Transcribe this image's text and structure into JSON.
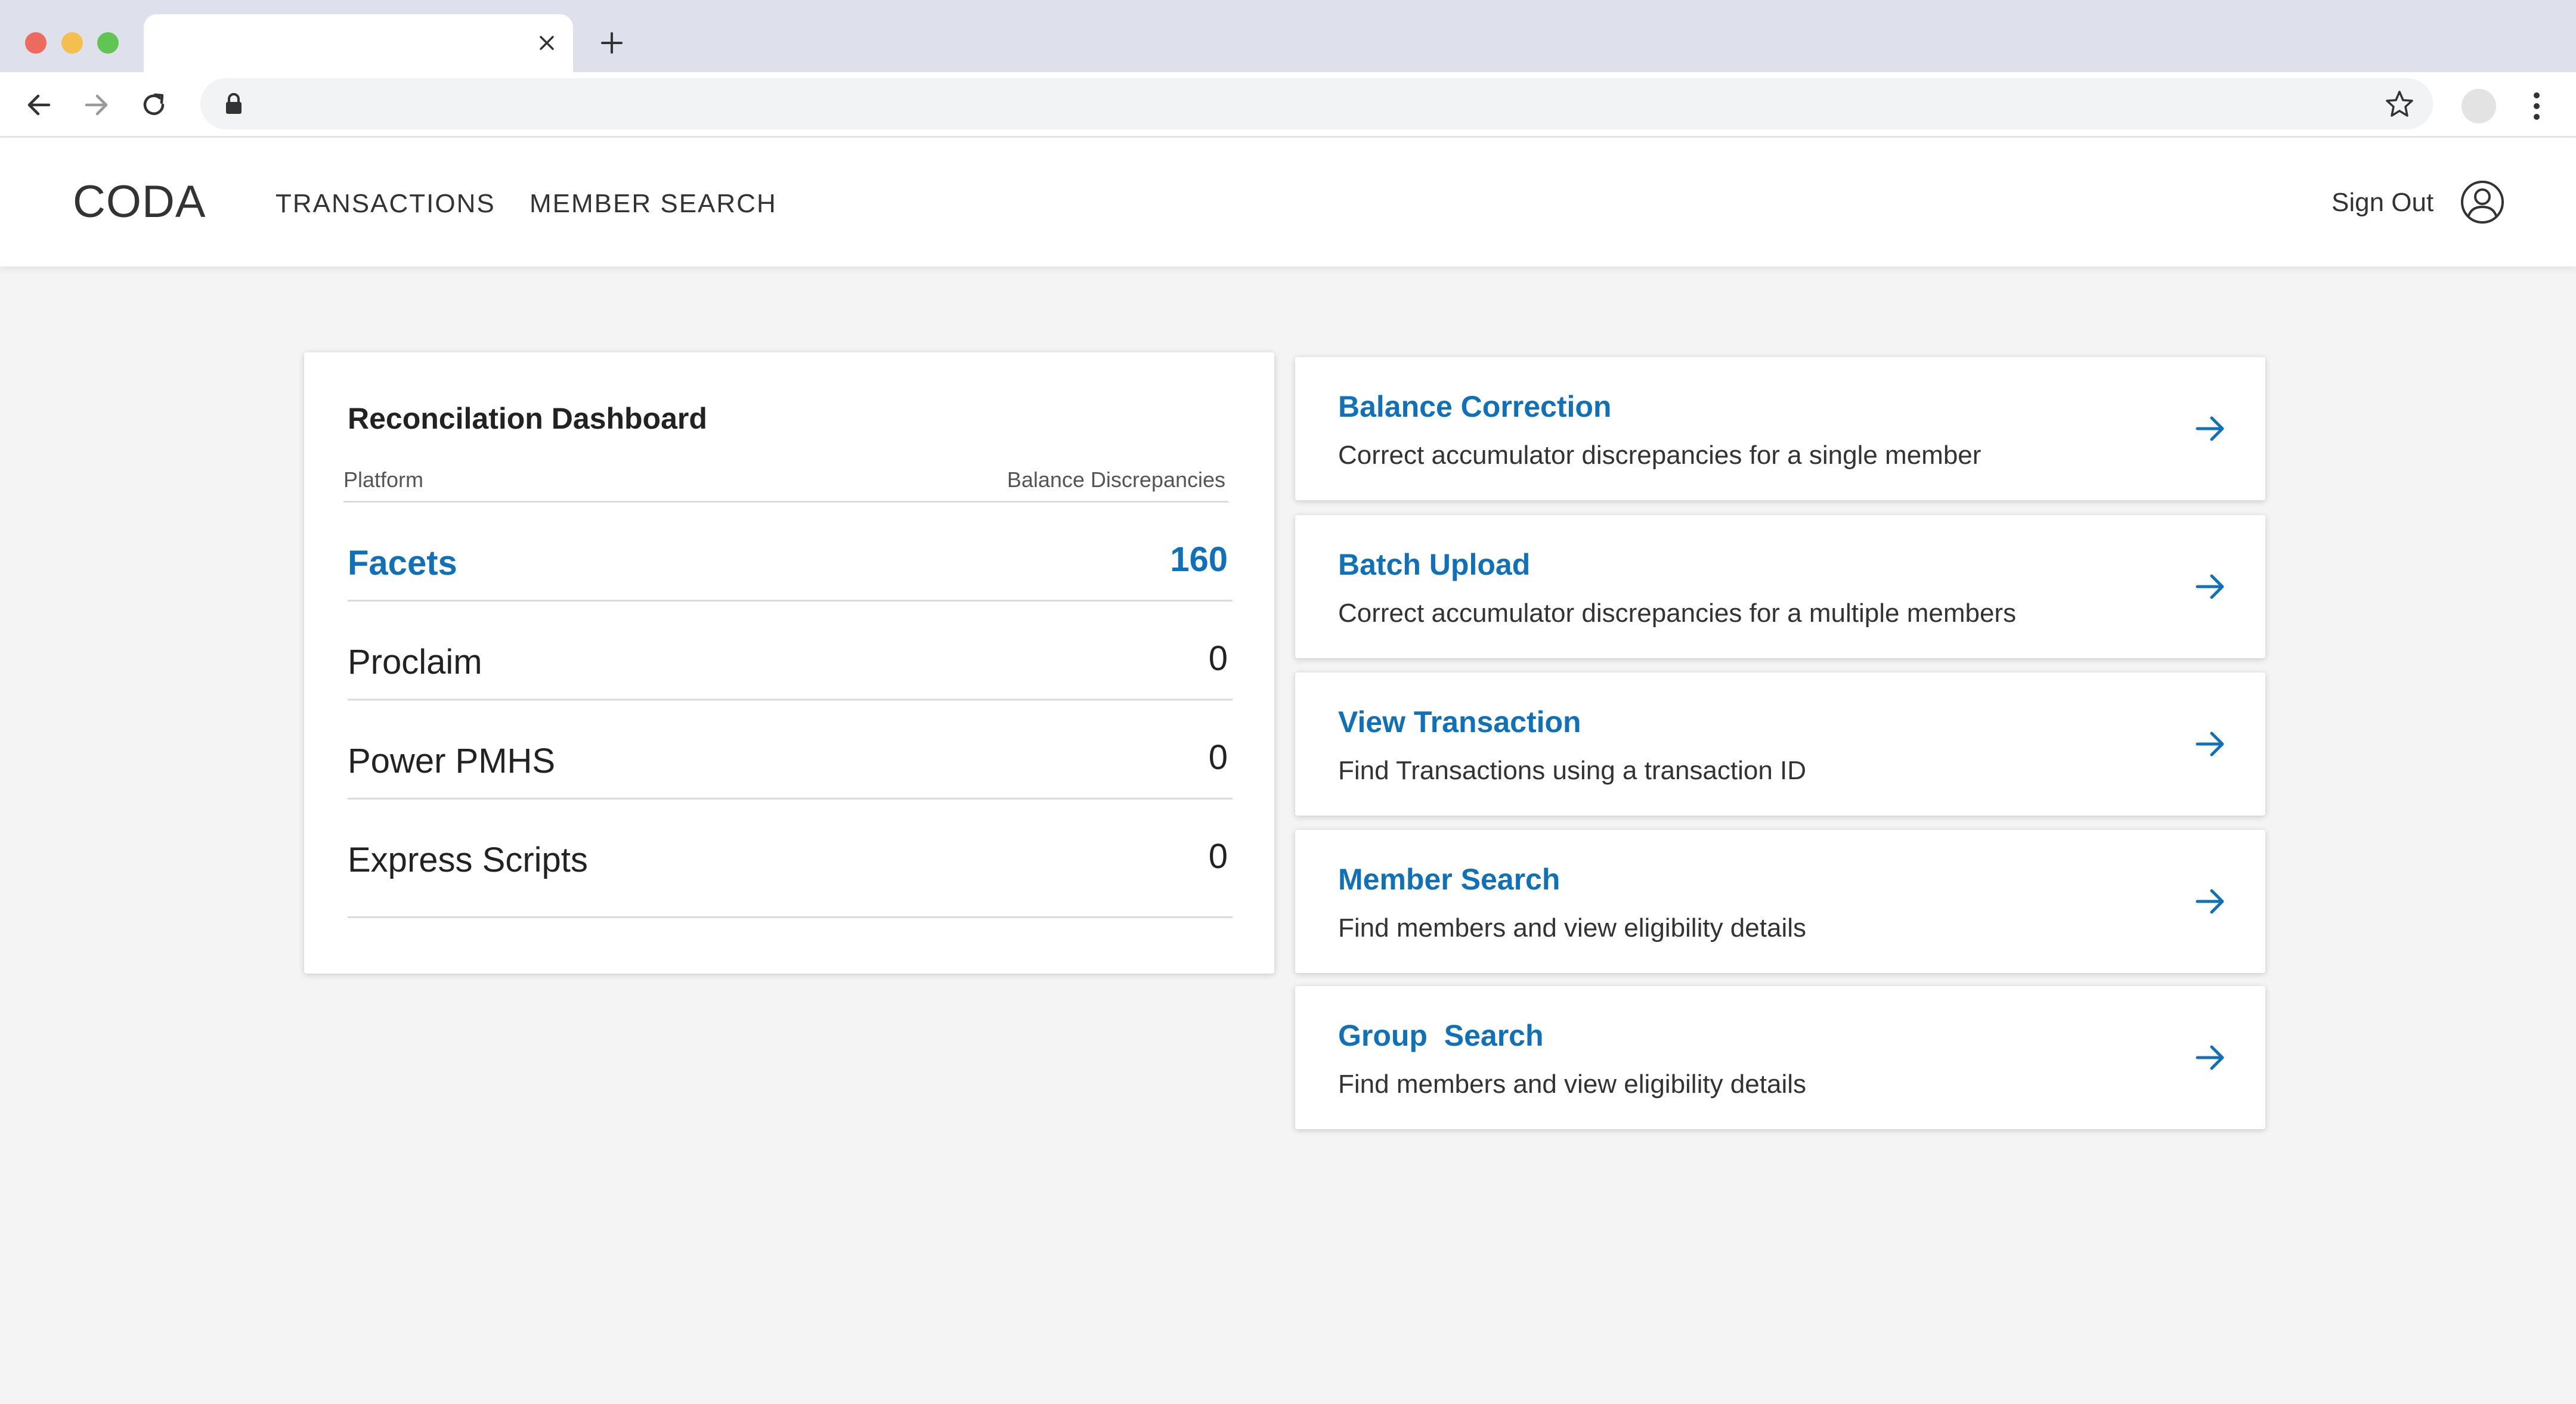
{
  "browser": {
    "tab_title": "",
    "address_value": "",
    "icons": [
      "close-icon",
      "plus-icon",
      "back-arrow-icon",
      "forward-arrow-icon",
      "reload-icon",
      "lock-icon",
      "star-icon",
      "kebab-menu-icon"
    ]
  },
  "header": {
    "brand": "CODA",
    "nav": [
      {
        "label": "TRANSACTIONS"
      },
      {
        "label": "MEMBER SEARCH"
      }
    ],
    "sign_out": "Sign Out",
    "user_icon": "user-circle-icon"
  },
  "recon": {
    "title": "Reconcilation Dashboard",
    "columns": {
      "platform": "Platform",
      "discrepancies": "Balance Discrepancies"
    },
    "rows": [
      {
        "platform": "Facets",
        "value": "160",
        "active": true
      },
      {
        "platform": "Proclaim",
        "value": "0"
      },
      {
        "platform": "Power PMHS",
        "value": "0"
      },
      {
        "platform": "Express Scripts",
        "value": "0"
      }
    ]
  },
  "actions": [
    {
      "title": "Balance Correction",
      "desc": "Correct accumulator discrepancies for a single member"
    },
    {
      "title": "Batch Upload",
      "desc": "Correct accumulator discrepancies for a multiple members"
    },
    {
      "title": "View Transaction",
      "desc": "Find Transactions using a transaction ID"
    },
    {
      "title": "Member Search",
      "desc": "Find members and view eligibility details"
    },
    {
      "title": "Group  Search",
      "desc": "Find members and view eligibility details"
    }
  ],
  "colors": {
    "accent": "#1071b8",
    "page_bg": "#f4f4f4",
    "chrome": "#dee1ec"
  }
}
